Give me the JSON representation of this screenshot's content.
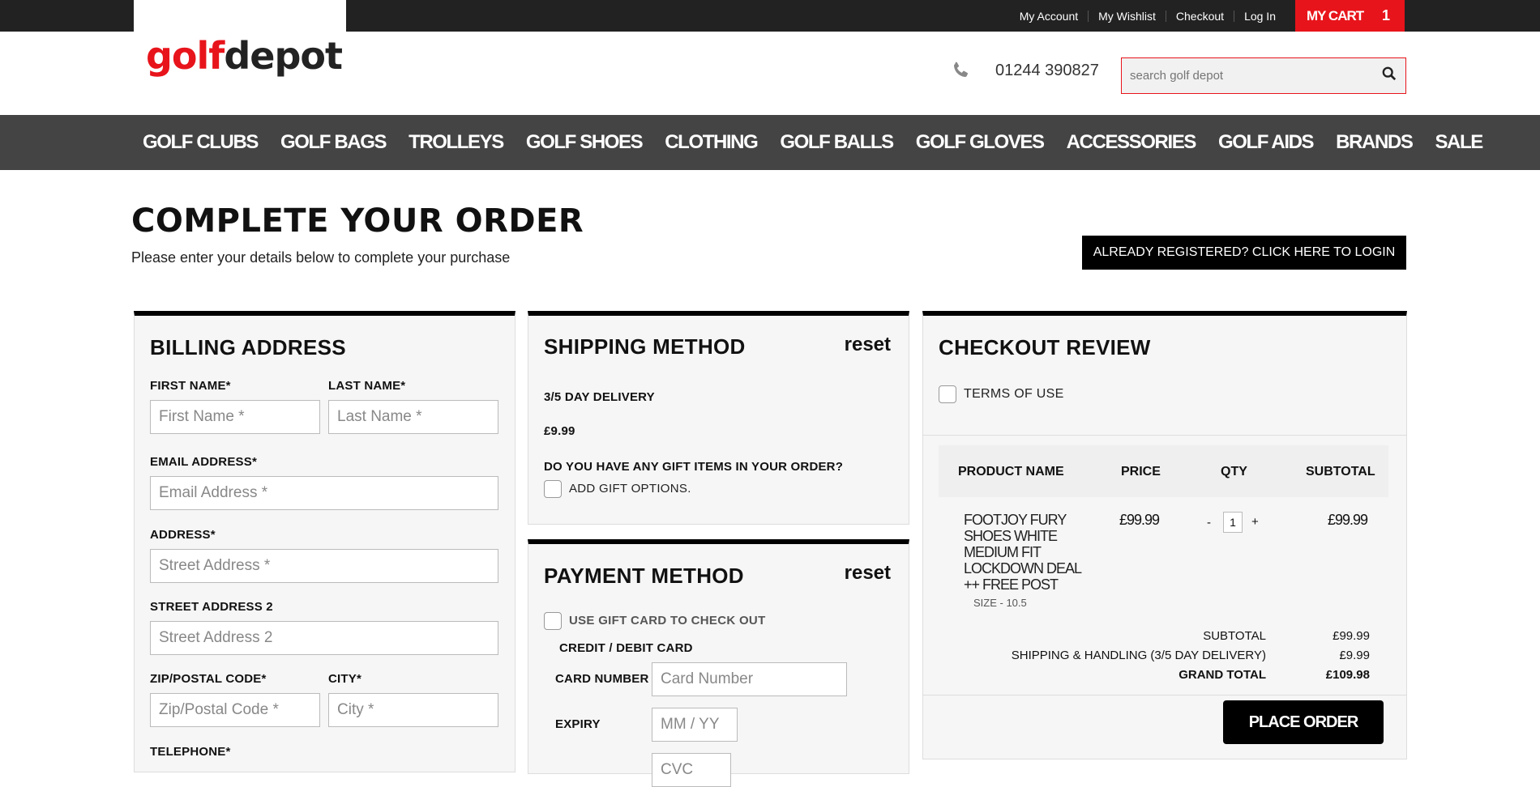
{
  "topbar": {
    "links": [
      "My Account",
      "My Wishlist",
      "Checkout",
      "Log In"
    ],
    "cart_label": "MY CART",
    "cart_count": "1"
  },
  "header": {
    "logo_part1": "golf",
    "logo_part2": "depot",
    "phone": "01244 390827",
    "search_placeholder": "search golf depot"
  },
  "nav": [
    "GOLF CLUBS",
    "GOLF BAGS",
    "TROLLEYS",
    "GOLF SHOES",
    "CLOTHING",
    "GOLF BALLS",
    "GOLF GLOVES",
    "ACCESSORIES",
    "GOLF AIDS",
    "BRANDS",
    "SALE"
  ],
  "page": {
    "title": "COMPLETE YOUR ORDER",
    "subtitle": "Please enter your details below to complete your purchase",
    "login_button": "ALREADY REGISTERED? CLICK HERE TO LOGIN"
  },
  "billing": {
    "title": "BILLING ADDRESS",
    "first_name_label": "FIRST NAME",
    "first_name_placeholder": "First Name *",
    "last_name_label": "LAST NAME",
    "last_name_placeholder": "Last Name *",
    "email_label": "EMAIL ADDRESS",
    "email_placeholder": "Email Address *",
    "address_label": "ADDRESS",
    "address_placeholder": "Street Address *",
    "street2_label": "STREET ADDRESS 2",
    "street2_placeholder": "Street Address 2",
    "zip_label": "ZIP/POSTAL CODE",
    "zip_placeholder": "Zip/Postal Code *",
    "city_label": "CITY",
    "city_placeholder": "City *",
    "telephone_label": "TELEPHONE",
    "required_mark": "*"
  },
  "shipping": {
    "title": "SHIPPING METHOD",
    "reset": "reset",
    "method": "3/5 DAY DELIVERY",
    "price": "£9.99",
    "gift_question": "DO YOU HAVE ANY GIFT ITEMS IN YOUR ORDER?",
    "gift_option": "ADD GIFT OPTIONS."
  },
  "payment": {
    "title": "PAYMENT METHOD",
    "reset": "reset",
    "gift_card": "USE GIFT CARD TO CHECK OUT",
    "card_heading": "CREDIT / DEBIT CARD",
    "card_number_label": "CARD NUMBER",
    "card_number_placeholder": "Card Number",
    "expiry_label": "EXPIRY",
    "expiry_placeholder": "MM / YY",
    "cvc_placeholder": "CVC"
  },
  "review": {
    "title": "CHECKOUT REVIEW",
    "terms": "TERMS OF USE",
    "columns": [
      "PRODUCT NAME",
      "PRICE",
      "QTY",
      "SUBTOTAL"
    ],
    "item": {
      "name_lines": [
        "FOOTJOY FURY",
        "SHOES WHITE",
        "MEDIUM FIT",
        "LOCKDOWN DEAL",
        "++ FREE POST"
      ],
      "size": "SIZE - 10.5",
      "price": "£99.99",
      "qty_minus": "-",
      "qty": "1",
      "qty_plus": "+",
      "subtotal": "£99.99"
    },
    "totals": {
      "subtotal_label": "SUBTOTAL",
      "subtotal": "£99.99",
      "shipping_label": "SHIPPING & HANDLING (3/5 DAY DELIVERY)",
      "shipping": "£9.99",
      "grand_label": "GRAND TOTAL",
      "grand": "£109.98"
    },
    "place_order": "PLACE ORDER"
  }
}
